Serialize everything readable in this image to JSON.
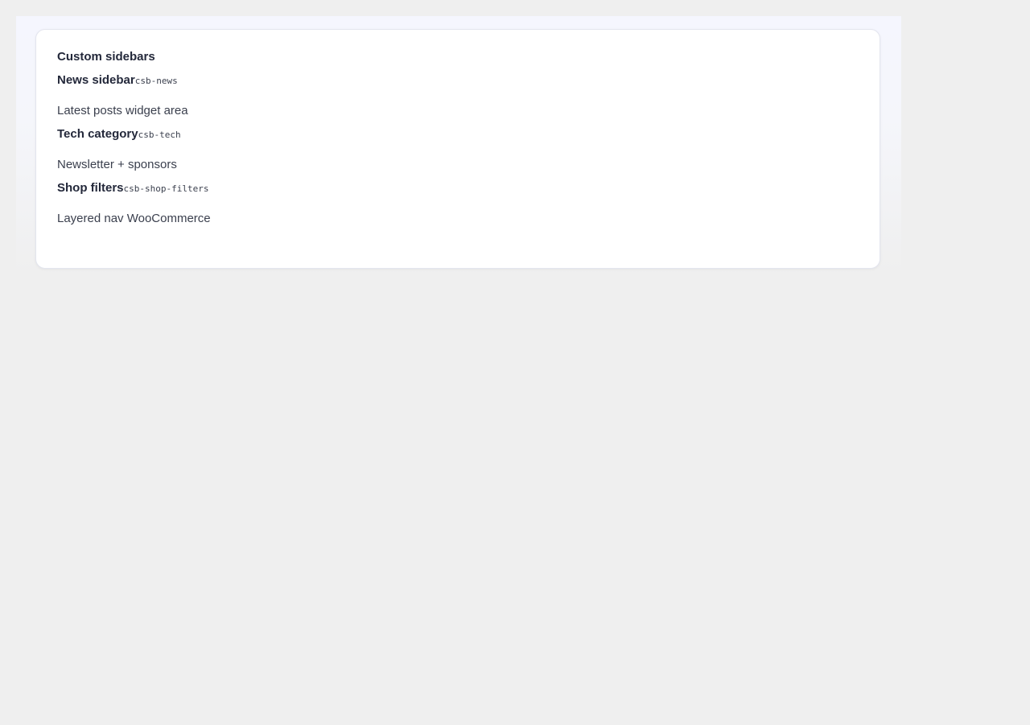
{
  "panel": {
    "title": "Custom sidebars"
  },
  "sidebars": [
    {
      "name": "News sidebar",
      "slug": "csb-news",
      "description": "Latest posts widget area"
    },
    {
      "name": "Tech category",
      "slug": "csb-tech",
      "description": "Newsletter + sponsors"
    },
    {
      "name": "Shop filters",
      "slug": "csb-shop-filters",
      "description": "Layered nav WooCommerce"
    }
  ]
}
